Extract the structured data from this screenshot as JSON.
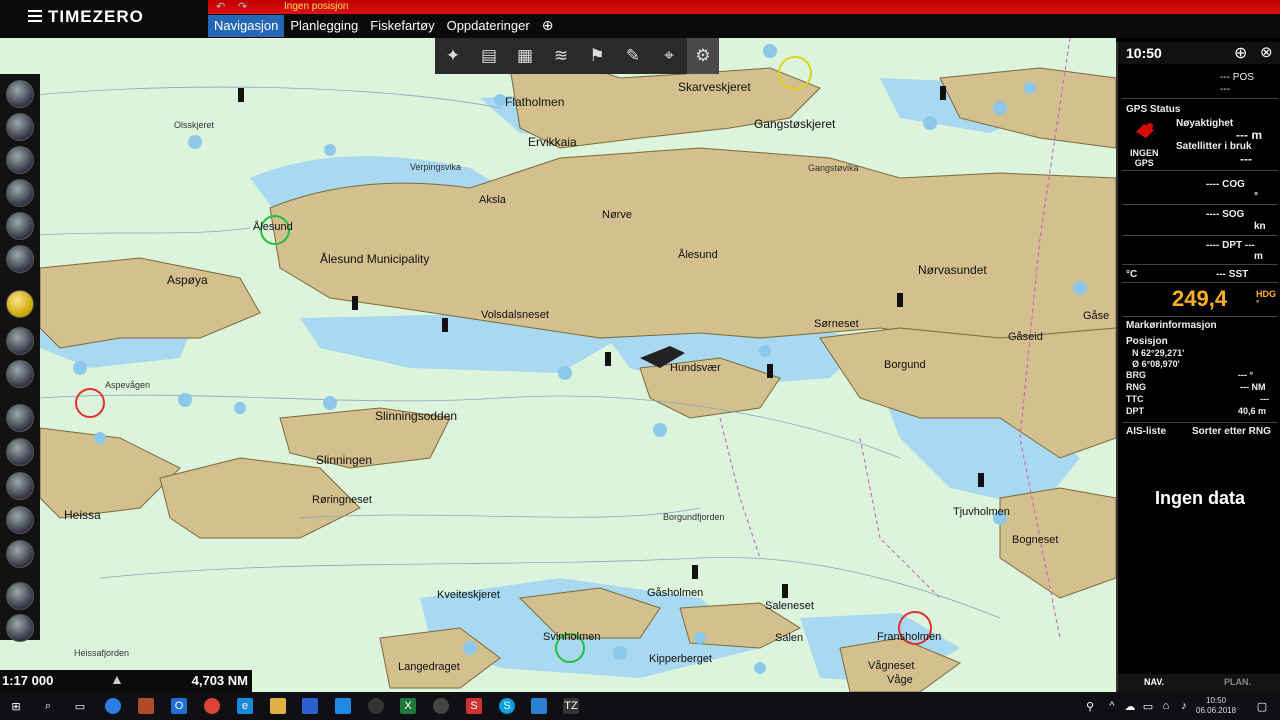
{
  "app": {
    "logo": "TIMEZERO",
    "status": "Ingen posisjon"
  },
  "tabs": [
    {
      "label": "Navigasjon",
      "active": true
    },
    {
      "label": "Planlegging"
    },
    {
      "label": "Fiskefartøy"
    },
    {
      "label": "Oppdateringer"
    }
  ],
  "tab_add": "⊕",
  "map_labels": {
    "flatholmen": "Flatholmen",
    "skarveskjeret": "Skarveskjeret",
    "gangstoskjeret": "Gangstøskjeret",
    "ervikkaia": "Ervikkaia",
    "olsskjeret": "Olsskjeret",
    "verpingsvika": "Verpingsvika",
    "gangstovika": "Gangstøvika",
    "aksla": "Aksla",
    "norve": "Nørve",
    "alesund_top": "Ålesund",
    "alesund_muni": "Ålesund Municipality",
    "alesund_city": "Ålesund",
    "aspoya": "Aspøya",
    "norvasundet": "Nørvasundet",
    "volsdalsneset": "Volsdalsneset",
    "sorneset": "Sørneset",
    "gaseid": "Gåseid",
    "gase": "Gåse",
    "hundsvaer": "Hundsvær",
    "borgund": "Borgund",
    "aspevagen": "Aspevågen",
    "slinningsodden": "Slinningsodden",
    "slinningen": "Slinningen",
    "roringneset": "Røringneset",
    "heissa": "Heissa",
    "borgundfjorden": "Borgundfjorden",
    "tjuvholmen": "Tjuvholmen",
    "bogneset": "Bogneset",
    "kveiteskjeret": "Kveiteskjeret",
    "gasholmen": "Gåsholmen",
    "saleneset": "Saleneset",
    "svinholmen": "Svinholmen",
    "salen": "Salen",
    "fransholmen": "Fransholmen",
    "heissafjorden": "Heissafjorden",
    "langedraget": "Langedraget",
    "kipperberget": "Kipperberget",
    "vagneset": "Vågneset",
    "vage": "Våge"
  },
  "scale": {
    "scale": "1:17 000",
    "range": "4,703 NM"
  },
  "panel": {
    "clock": "10:50",
    "pos_value": "--- POS",
    "pos_dash": "---",
    "gps_status_title": "GPS Status",
    "gps_none": "INGEN\nGPS",
    "accuracy_label": "Nøyaktighet",
    "accuracy_value": "--- m",
    "satellites_label": "Satellitter i bruk",
    "satellites_value": "---",
    "cog": "---- COG",
    "cog_unit": "°",
    "sog": "---- SOG",
    "sog_unit": "kn",
    "dpt_top": "---- DPT ---",
    "dpt_unit": "m",
    "sst_unit": "°C",
    "sst": "--- SST",
    "hdg_value": "249,4",
    "hdg_unit": "HDG\n°",
    "marker_info": "Markørinformasjon",
    "position_label": "Posisjon",
    "lat": "N 62°29,271'",
    "lon": "Ø 6°08,970'",
    "brg_label": "BRG",
    "brg_value": "--- °",
    "rng_label": "RNG",
    "rng_value": "--- NM",
    "ttc_label": "TTC",
    "ttc_value": "---",
    "dpt_label": "DPT",
    "dpt_value": "40,6 m",
    "ais_label": "AIS-liste",
    "ais_sort": "Sorter etter RNG",
    "no_data": "Ingen data",
    "tab_nav": "NAV.",
    "tab_plan": "PLAN."
  },
  "taskbar": {
    "time": "10:50",
    "date": "06.06.2018"
  },
  "colors": {
    "land": "#d4c08e",
    "water_shallow": "#a9d9f0",
    "water_deep": "#dcf4dc",
    "hdg": "#ffb020",
    "tab_active": "#2567b7",
    "alert": "#d80a0a"
  }
}
